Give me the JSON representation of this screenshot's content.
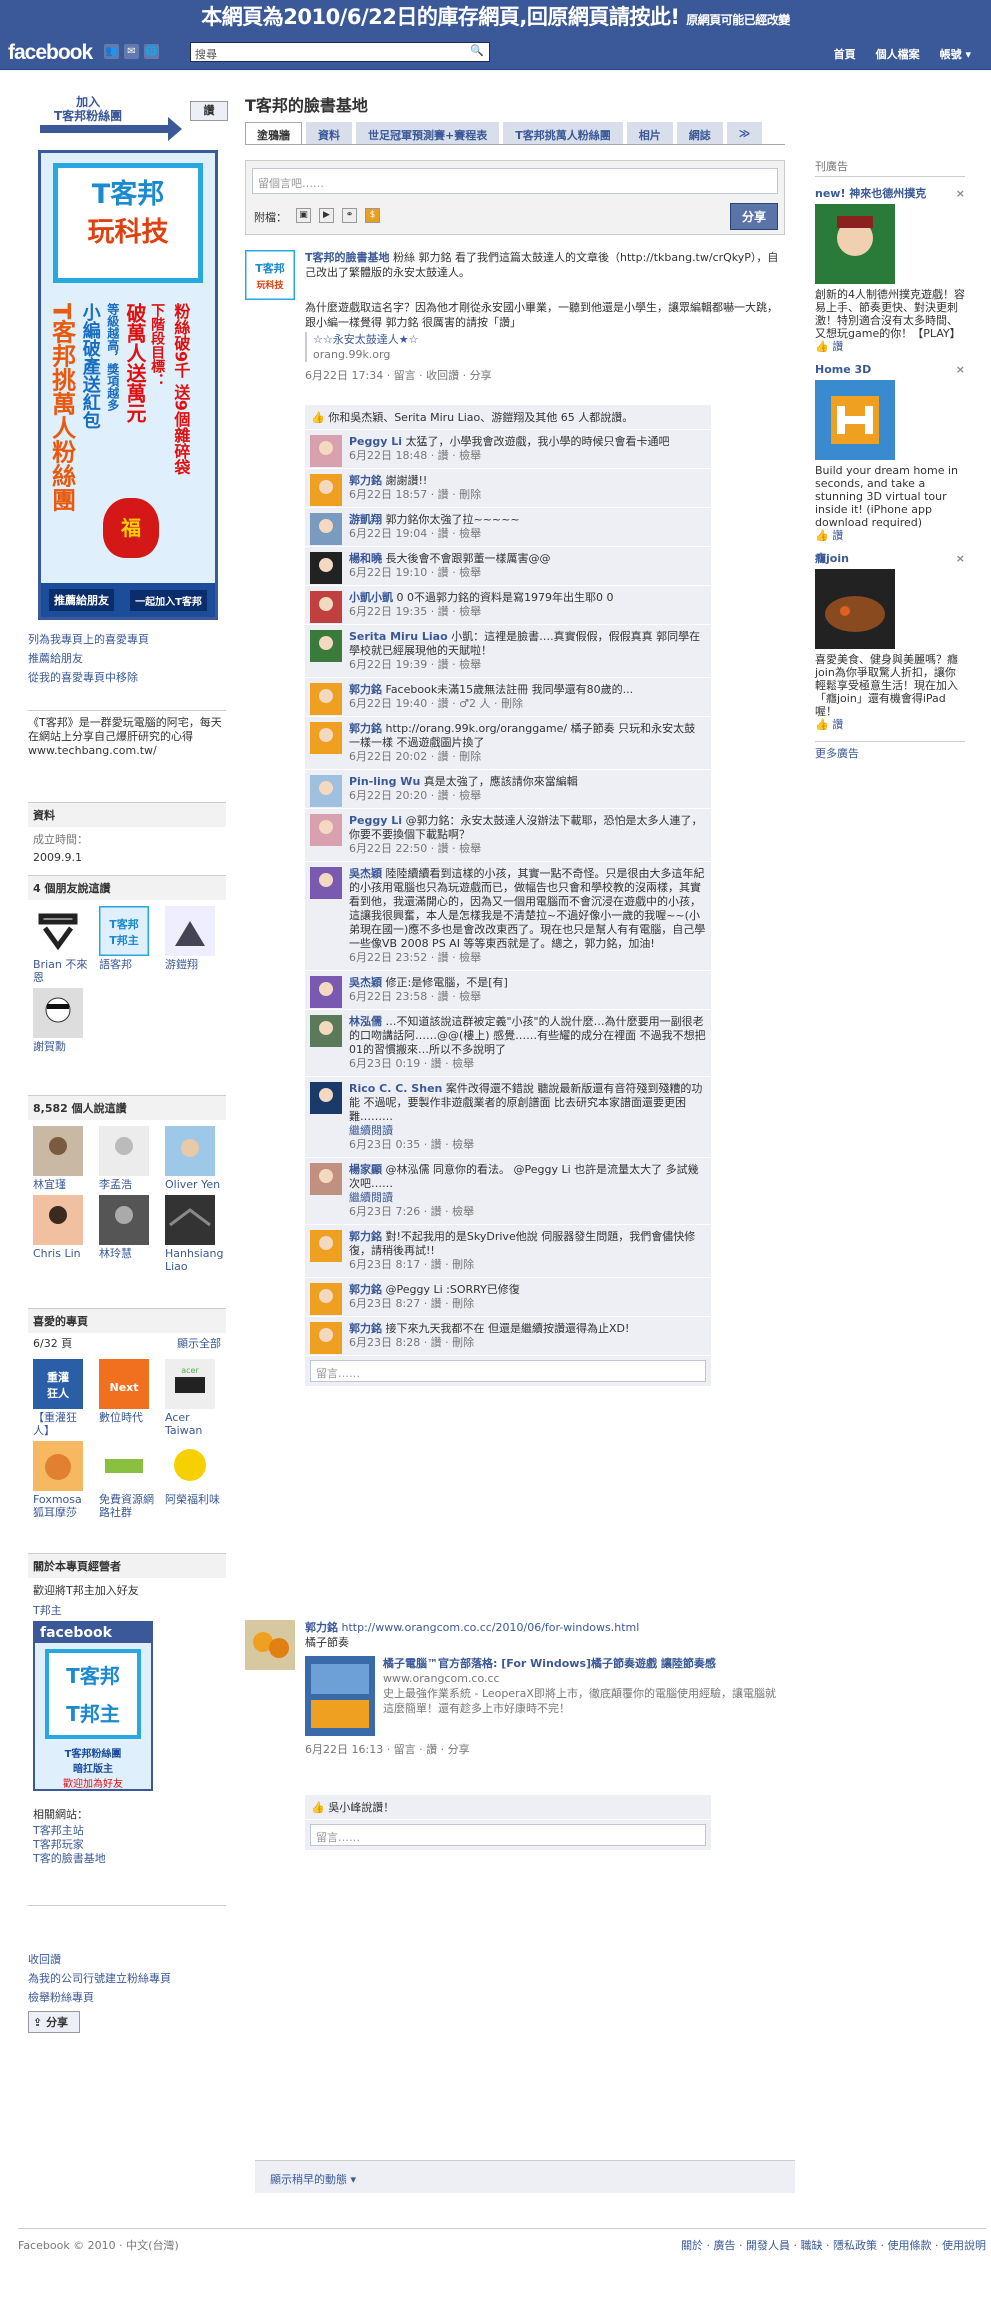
{
  "archive_banner": {
    "main": "本網頁為2010/6/22日的庫存網頁,回原網頁請按此!",
    "note": "原網頁可能已經改變"
  },
  "topbar": {
    "logo": "facebook",
    "search_placeholder": "搜尋",
    "nav": [
      "首頁",
      "個人檔案",
      "帳號 ▾"
    ]
  },
  "left": {
    "join_text": "加入\nT客邦粉絲團",
    "like_button": "讚",
    "promo": {
      "logo_line1": "T客邦",
      "logo_line2": "玩科技",
      "vert1": "T客邦挑萬人粉絲團",
      "vert2": "小編破產送紅包",
      "vert3": "等級越高，獎項越多",
      "vert4": "破萬人送萬元",
      "vert5": "下階段目標：",
      "vert6": "粉絲破9千 送9個雜碎袋",
      "btn1": "推薦給朋友",
      "btn2": "一起加入T客邦"
    },
    "links": [
      "列為我專頁上的喜愛專頁",
      "推薦給朋友",
      "從我的喜愛專頁中移除"
    ],
    "about": "《T客邦》是一群愛玩電腦的阿宅，每天在網站上分享自己爆肝研究的心得",
    "about_url": "www.techbang.com.tw/",
    "info_title": "資料",
    "info_label": "成立時間：",
    "info_value": "2009.9.1",
    "friends_title": "4 個朋友說這讚",
    "friends": [
      "Brian 不來恩",
      "語客邦",
      "游鎧翔",
      "謝賀勳"
    ],
    "people_title": "8,582 個人說這讚",
    "people": [
      "林宜瑾",
      "李孟浩",
      "Oliver Yen",
      "Chris Lin",
      "林玲慧",
      "Hanhsiang Liao"
    ],
    "fav_title": "喜愛的專頁",
    "fav_count": "6/32 頁",
    "fav_show_all": "顯示全部",
    "favs": [
      "【重灌狂人】",
      "數位時代",
      "Acer Taiwan",
      "Foxmosa 狐耳摩莎",
      "免費資源網路社群",
      "阿榮福利味"
    ],
    "admin_title": "關於本專頁經營者",
    "admin_text": "歡迎將T邦主加入好友",
    "admin_name": "T邦主",
    "admin_badge": "facebook",
    "admin_box_line1": "T客邦",
    "admin_box_line2": "T邦主",
    "admin_caption1": "T客邦粉絲團",
    "admin_caption2": "暗扛版主",
    "admin_caption3": "歡迎加為好友",
    "related_title": "相關網站：",
    "related": [
      "T客邦主站",
      "T客邦玩家",
      "T客的臉書基地"
    ],
    "bottom_links": [
      "收回讚",
      "為我的公司行號建立粉絲專頁",
      "檢舉粉絲專頁"
    ],
    "share_label": "分享"
  },
  "main": {
    "title": "T客邦的臉書基地",
    "tabs": [
      "塗鴉牆",
      "資料",
      "世足冠軍預測賽+賽程表",
      "T客邦挑萬人粉絲團",
      "相片",
      "網誌",
      "≫"
    ],
    "composer_placeholder": "留個言吧……",
    "attach_label": "附檔：",
    "share_button": "分享",
    "post1": {
      "author": "T客邦的臉書基地",
      "text": "粉絲 郭力銘 看了我們這篇太鼓達人的文章後（http://tkbang.tw/crQkyP），自己改出了繁體版的永安太鼓達人。",
      "desc": "為什麼遊戲取這名字？因為他才剛從永安國小畢業，一聽到他還是小學生，讓眾編輯都嚇一大跳，跟小編一樣覺得 郭力銘 很厲害的請按「讚」",
      "link_title": "☆☆永安太鼓達人★☆",
      "link_domain": "orang.99k.org",
      "meta": "6月22日 17:34 · 留言 · 收回讚 · 分享",
      "likes": "你和吳杰穎、Serita Miru Liao、游鎧翔及其他 65 人都說讚。",
      "comments": [
        {
          "name": "Peggy Li",
          "text": "太猛了，小學我會改遊戲，我小學的時候只會看卡通吧",
          "meta": "6月22日 18:48 · 讚 · 檢舉"
        },
        {
          "name": "郭力銘",
          "text": "謝謝讚!!",
          "meta": "6月22日 18:57 · 讚 · 刪除"
        },
        {
          "name": "游凱翔",
          "text": "郭力銘你太強了拉~~~~~",
          "meta": "6月22日 19:04 · 讚 · 檢舉"
        },
        {
          "name": "楊和曉",
          "text": "長大後會不會跟郭董一樣厲害@@",
          "meta": "6月22日 19:10 · 讚 · 檢舉"
        },
        {
          "name": "小凱小凱",
          "text": "0 0不過郭力銘的資料是寫1979年出生耶0 0",
          "meta": "6月22日 19:35 · 讚 · 檢舉"
        },
        {
          "name": "Serita Miru Liao",
          "text": "小凱：這裡是臉書….真實假假，假假真真 郭同學在學校就已經展現他的天賦啦！",
          "meta": "6月22日 19:39 · 讚 · 檢舉"
        },
        {
          "name": "郭力銘",
          "text": "Facebook未滿15歲無法註冊 我同學還有80歲的...",
          "meta": "6月22日 19:40 · 讚 · ♂2 人 · 刪除"
        },
        {
          "name": "郭力銘",
          "text": "http://orang.99k.org/oranggame/ 橘子節奏 只玩和永安太鼓一樣一樣 不過遊戲圖片換了",
          "meta": "6月22日 20:02 · 讚 · 刪除"
        },
        {
          "name": "Pin-ling Wu",
          "text": "真是太強了，應該請你來當編輯",
          "meta": "6月22日 20:20 · 讚 · 檢舉"
        },
        {
          "name": "Peggy Li",
          "text": "@郭力銘：永安太鼓達人沒辦法下載耶，恐怕是太多人連了，你要不要換個下載點啊？",
          "meta": "6月22日 22:50 · 讚 · 檢舉"
        },
        {
          "name": "吳杰穎",
          "text": "陸陸續續看到這樣的小孩，其實一點不奇怪。只是很由大多這年紀的小孩用電腦也只為玩遊戲而已，做幅告也只會和學校教的沒兩樣，其實看到他，我還滿開心的，因為又一個用電腦而不會沉浸在遊戲中的小孩，這讓我很興奮，本人是怎樣我是不清楚拉~不過好像小一歲的我喔~~(小弟現在國一)應不多也是會改改東西了。現在也只是幫人有有電腦，自己學一些像VB 2008 PS AI 等等東西就是了。總之，郭力銘，加油!",
          "meta": "6月22日 23:52 · 讚 · 檢舉"
        },
        {
          "name": "吳杰穎",
          "text": "修正:是修電腦，不是[有]",
          "meta": "6月22日 23:58 · 讚 · 檢舉"
        },
        {
          "name": "林泓儒",
          "text": "…不知道該說這群被定義\"小孩\"的人說什麼…為什麼要用一副很老的口吻講話阿……@@(樓上) 感覺……有些耀的成分在裡面 不過我不想把01的習慣搬來…所以不多說明了",
          "meta": "6月23日 0:19 · 讚 · 檢舉"
        },
        {
          "name": "Rico C. C. Shen",
          "text": "案件改得還不錯說 聽說最新版還有音符殘到殘糟的功能 不過呢，要製作非遊戲業者的原創譜面 比去研究本家譜面還要更困難………",
          "meta": "6月23日 0:35 · 讚 · 檢舉",
          "more": "繼續閱讀"
        },
        {
          "name": "楊家顯",
          "text": "@林泓儒 同意你的看法。 @Peggy Li 也許是流量太大了 多試幾次吧……",
          "meta": "6月23日 7:26 · 讚 · 檢舉",
          "more": "繼續閱讀"
        },
        {
          "name": "郭力銘",
          "text": "對!不起我用的是SkyDrive他說 伺服器發生問題，我們會儘快修復，請稍後再試!!",
          "meta": "6月23日 8:17 · 讚 · 刪除"
        },
        {
          "name": "郭力銘",
          "text": "@Peggy Li :SORRY已修復",
          "meta": "6月23日 8:27 · 讚 · 刪除"
        },
        {
          "name": "郭力銘",
          "text": "接下來九天我都不在 但還是繼續按讚還得為止XD!",
          "meta": "6月23日 8:28 · 讚 · 刪除"
        }
      ],
      "comment_placeholder": "留言……"
    },
    "post2": {
      "author": "郭力銘",
      "link": "http://www.orangcom.co.cc/2010/06/for-windows.html",
      "sub": "橘子節奏",
      "title": "橘子電腦™官方部落格: [For Windows]橘子節奏遊戲 讓陸節奏感",
      "domain": "www.orangcom.co.cc",
      "desc": "史上最強作業系統 - LeoperaX即將上市，徹底顛覆你的電腦使用經驗，讓電腦就這麼簡單！還有趁多上市好康時不完！",
      "meta": "6月22日 16:13 · 留言 · 讚 · 分享",
      "likes": "吳小峰說讚！",
      "comment_placeholder": "留言……"
    },
    "more_posts": "顯示稍早的動態 ▾"
  },
  "right": {
    "title": "刊廣告",
    "ads": [
      {
        "title": "new! 神來也德州撲克",
        "text": "創新的4人制德州撲克遊戲！容易上手、節奏更快、對決更刺激！特別適合沒有太多時間、又想玩game的你！【PLAY】",
        "like": "讚"
      },
      {
        "title": "Home 3D",
        "text": "Build your dream home in seconds, and take a stunning 3D virtual tour inside it! (iPhone app download required)",
        "like": "讚"
      },
      {
        "title": "癮join",
        "text": "喜愛美食、健身與美麗嗎？癮join為你爭取驚人折扣，讓你輕鬆享受極意生活！現在加入「癮join」還有機會得iPad喔！",
        "like": "讚"
      }
    ],
    "more_ads": "更多廣告"
  },
  "footer": {
    "copyright": "Facebook © 2010 · 中文(台灣)",
    "links": "關於 · 廣告 · 開發人員 · 職缺 · 隱私政策 · 使用條款 · 使用說明"
  }
}
